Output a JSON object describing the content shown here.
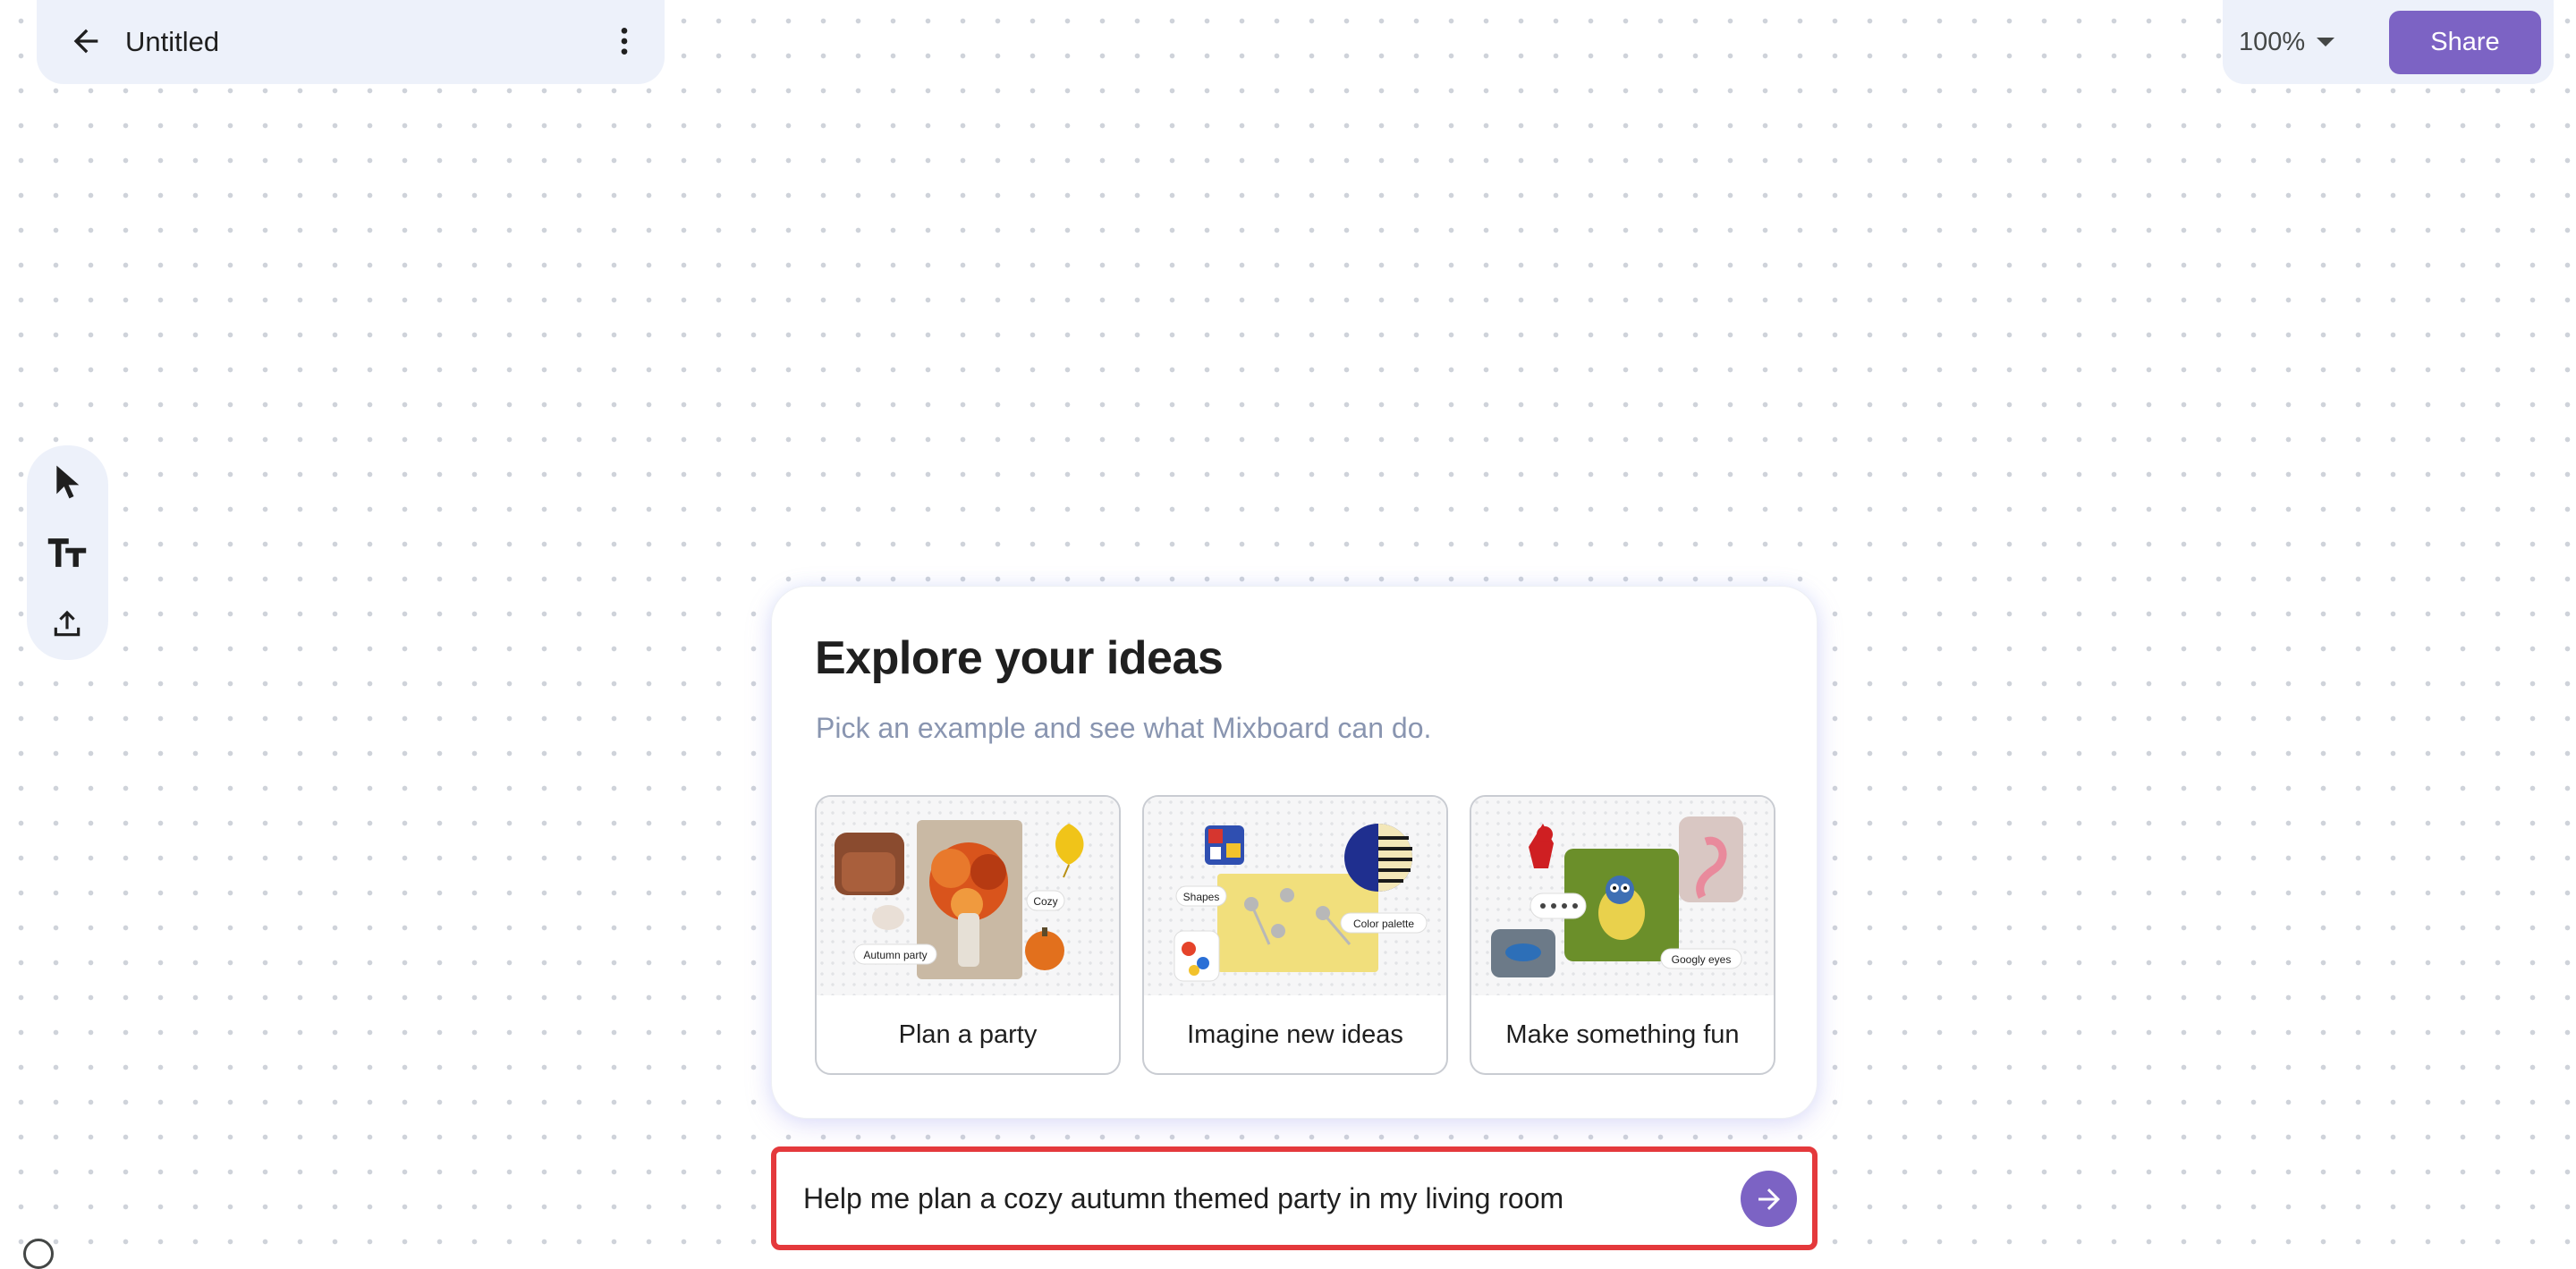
{
  "header": {
    "title": "Untitled",
    "back_icon": "arrow-back-icon",
    "more_icon": "more-vert-icon"
  },
  "toolbar_right": {
    "zoom_label": "100%",
    "share_label": "Share"
  },
  "tools": [
    {
      "name": "select",
      "icon": "cursor-pointer-icon"
    },
    {
      "name": "text",
      "icon": "text-tt-icon"
    },
    {
      "name": "upload",
      "icon": "upload-icon"
    }
  ],
  "explore": {
    "title": "Explore your ideas",
    "subtitle": "Pick an example and see what Mixboard can do.",
    "examples": [
      {
        "label": "Plan a party",
        "tags": [
          "Cozy",
          "Autumn party"
        ]
      },
      {
        "label": "Imagine new ideas",
        "tags": [
          "Shapes",
          "Color palette"
        ]
      },
      {
        "label": "Make something fun",
        "tags": [
          "Googly eyes"
        ]
      }
    ]
  },
  "prompt": {
    "value": "Help me plan a cozy autumn themed party in my living room",
    "send_icon": "arrow-forward-icon"
  },
  "colors": {
    "accent": "#7c63c4",
    "panel": "#edf1fa",
    "highlight": "#e4393c",
    "subtitle": "#8995b0"
  }
}
